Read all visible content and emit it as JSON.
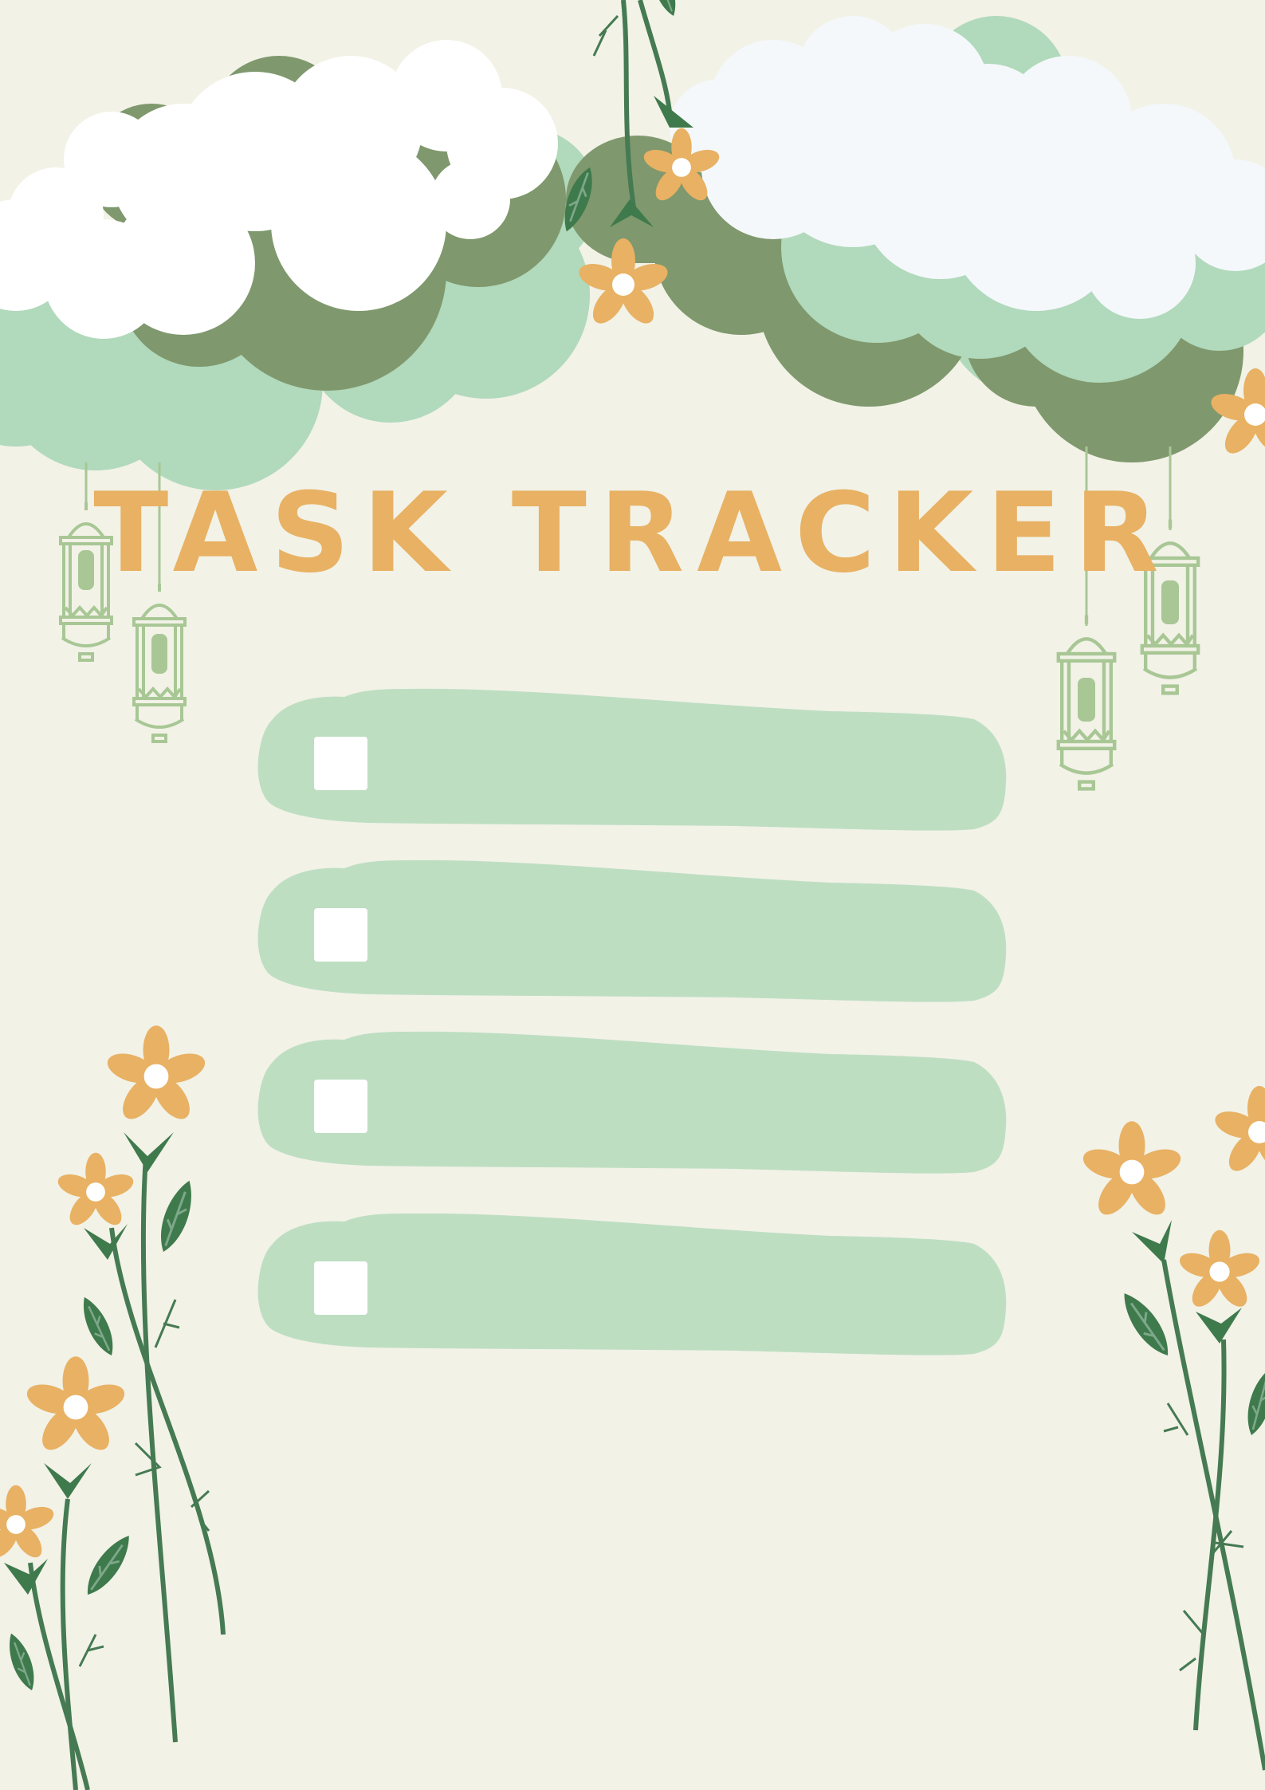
{
  "page": {
    "title": "TASK TRACKER"
  },
  "colors": {
    "background": "#f2f2e7",
    "title": "#e8b163",
    "task_fill": "#bedec2",
    "checkbox": "#ffffff",
    "cloud_dark": "#7f986d",
    "cloud_mint": "#b1d9bb",
    "cloud_white": "#ffffff",
    "cloud_whiteblue": "#f4f8fb",
    "lantern": "#a8c795",
    "stem": "#457a52",
    "leaf": "#3f7a4c",
    "petal": "#e8b163"
  },
  "tasks": [
    {
      "checked": false,
      "label": ""
    },
    {
      "checked": false,
      "label": ""
    },
    {
      "checked": false,
      "label": ""
    },
    {
      "checked": false,
      "label": ""
    }
  ],
  "decorations": {
    "top": [
      "cloud-cluster-left",
      "cloud-cluster-right",
      "hanging-vine",
      "lantern",
      "lantern",
      "lantern",
      "lantern"
    ],
    "bottom": [
      "flower-vine-left",
      "flower-vine-right"
    ]
  }
}
